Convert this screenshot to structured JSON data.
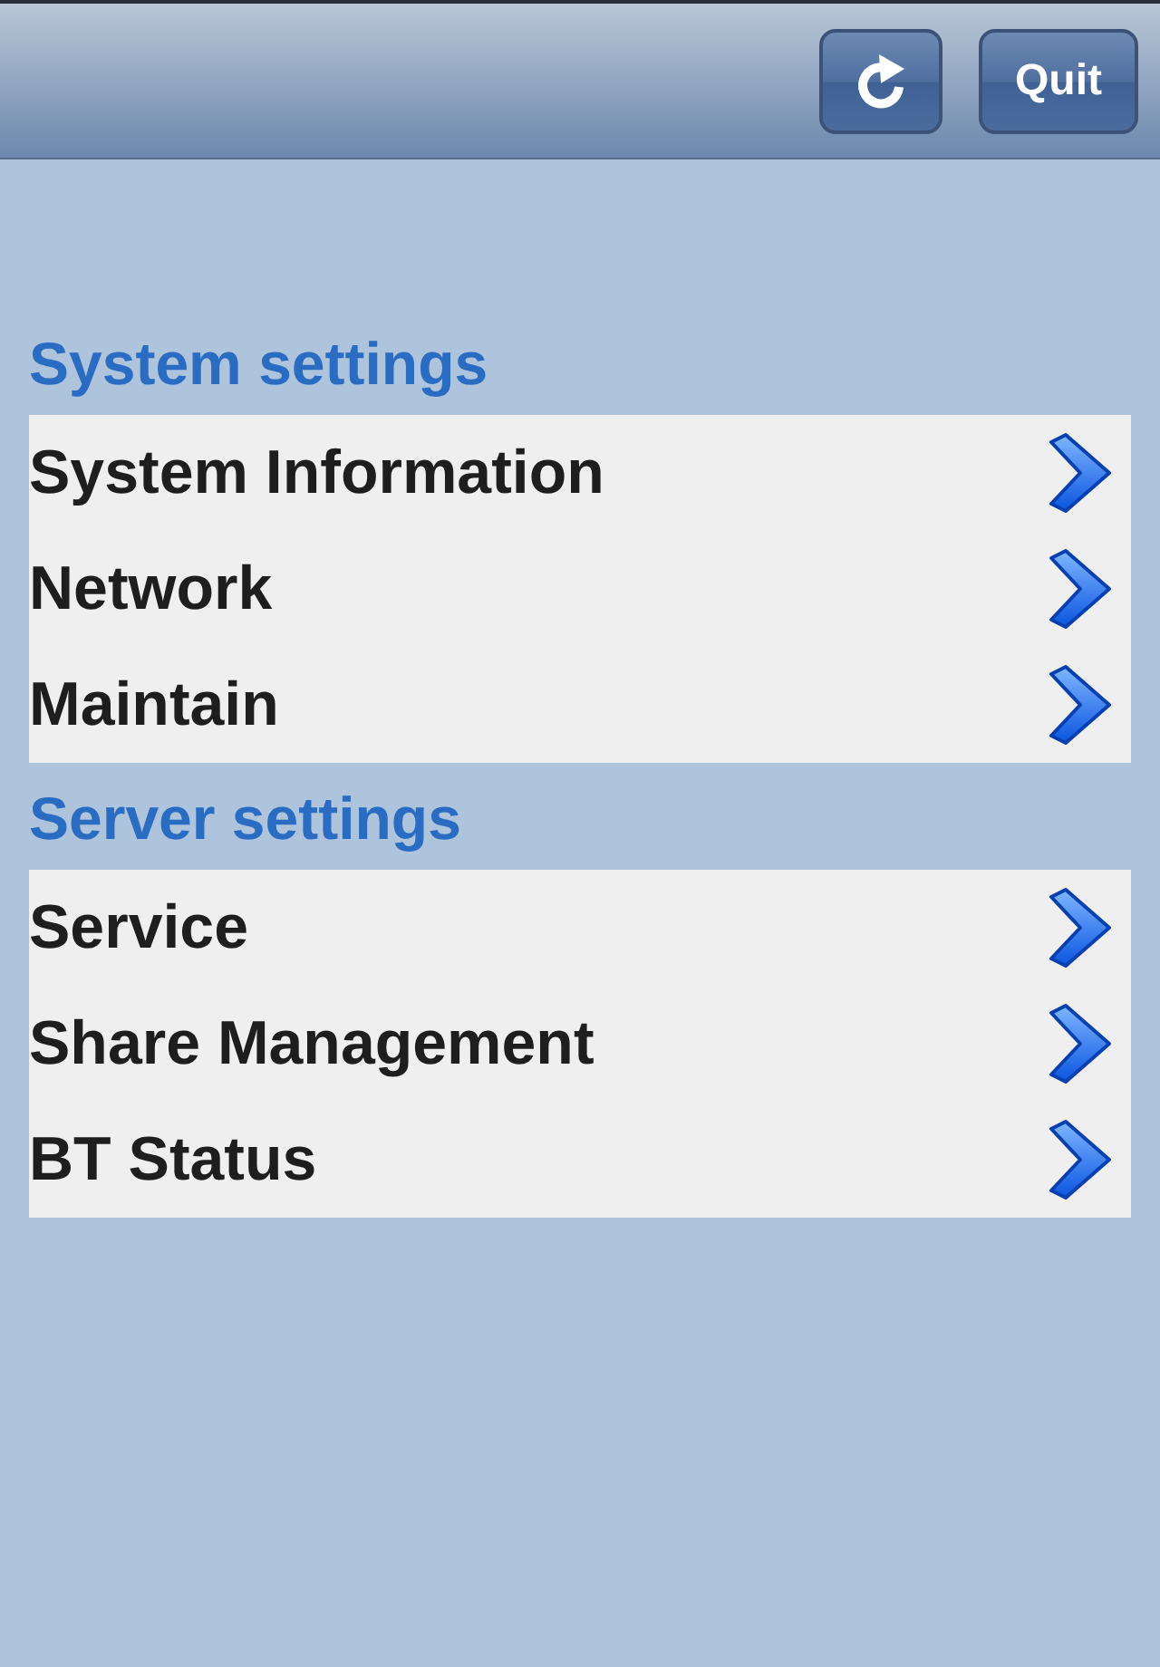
{
  "toolbar": {
    "buttons": [
      {
        "kind": "refresh"
      },
      {
        "kind": "text",
        "label": "Quit"
      }
    ]
  },
  "sections": [
    {
      "title": "System settings",
      "items": [
        {
          "label": "System Information"
        },
        {
          "label": "Network"
        },
        {
          "label": "Maintain"
        }
      ]
    },
    {
      "title": "Server settings",
      "items": [
        {
          "label": "Service"
        },
        {
          "label": "Share Management"
        },
        {
          "label": "BT Status"
        }
      ]
    }
  ]
}
